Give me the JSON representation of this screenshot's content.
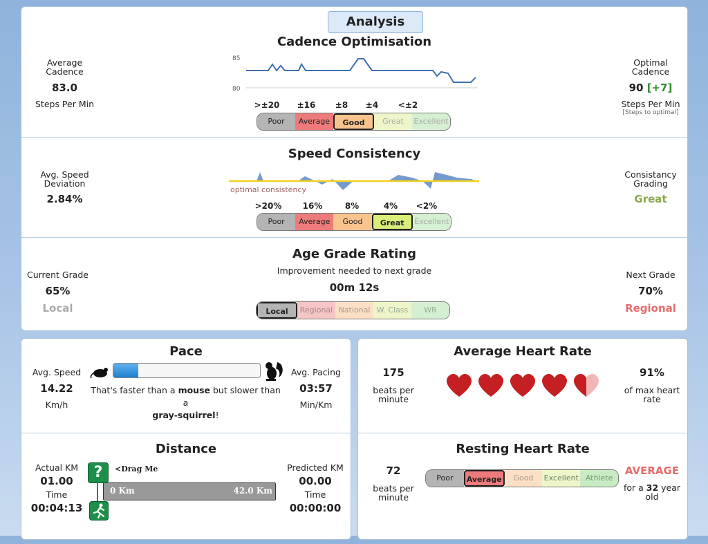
{
  "analysis": {
    "tab_label": "Analysis"
  },
  "cadence": {
    "title": "Cadence Optimisation",
    "avg_label": "Average\nCadence",
    "avg_value": "83.0",
    "avg_unit": "Steps Per Min",
    "optimal_label": "Optimal\nCadence",
    "optimal_value": "90",
    "optimal_delta": "[+7]",
    "optimal_unit": "Steps Per Min",
    "optimal_note": "[Steps to optimal]",
    "axis_high": "85",
    "axis_low": "80",
    "ticks": [
      ">±20",
      "±16",
      "±8",
      "±4",
      "<±2"
    ],
    "scale": [
      "Poor",
      "Average",
      "Good",
      "Great",
      "Excellent"
    ],
    "selected": "Good"
  },
  "speed": {
    "title": "Speed Consistency",
    "dev_label": "Avg. Speed\nDeviation",
    "dev_value": "2.84%",
    "grade_label": "Consistancy\nGrading",
    "grade_value": "Great",
    "chart_note": "optimal consistency",
    "ticks": [
      ">20%",
      "16%",
      "8%",
      "4%",
      "<2%"
    ],
    "scale": [
      "Poor",
      "Average",
      "Good",
      "Great",
      "Excellent"
    ],
    "selected": "Great"
  },
  "age": {
    "title": "Age Grade Rating",
    "subtitle": "Improvement needed to next grade",
    "time_needed": "00m 12s",
    "current_label": "Current Grade",
    "current_value": "65%",
    "current_grade": "Local",
    "next_label": "Next Grade",
    "next_value": "70%",
    "next_grade": "Regional",
    "scale": [
      "Local",
      "Regional",
      "National",
      "W. Class",
      "WR"
    ],
    "selected": "Local"
  },
  "pace": {
    "title": "Pace",
    "speed_label": "Avg. Speed",
    "speed_value": "14.22",
    "speed_unit": "Km/h",
    "pacing_label": "Avg. Pacing",
    "pacing_value": "03:57",
    "pacing_unit": "Min/Km",
    "compare_prefix": "That's faster than a ",
    "compare_a": "mouse",
    "compare_mid": " but slower than a",
    "compare_b": "gray-squirrel",
    "compare_suffix": "!",
    "progress": 0.17
  },
  "distance": {
    "title": "Distance",
    "actual_label": "Actual KM",
    "actual_value": "01.00",
    "time_label": "Time",
    "time_value": "00:04:13",
    "predicted_label": "Predicted KM",
    "predicted_value": "00.00",
    "pred_time_label": "Time",
    "pred_time_value": "00:00:00",
    "drag_label": "<Drag Me",
    "start_label": "0 Km",
    "end_label": "42.0 Km"
  },
  "avg_hr": {
    "title": "Average Heart Rate",
    "bpm_value": "175",
    "bpm_label": "beats per\nminute",
    "pct_value": "91%",
    "pct_label": "of max heart\nrate",
    "hearts_filled": 4.5,
    "hearts_total": 5
  },
  "rest_hr": {
    "title": "Resting Heart Rate",
    "bpm_value": "72",
    "bpm_label": "beats per\nminute",
    "rating": "AVERAGE",
    "age_prefix": "for a ",
    "age_value": "32",
    "age_suffix": " year\nold",
    "scale": [
      "Poor",
      "Average",
      "Good",
      "Excellent",
      "Athlete"
    ],
    "selected": "Average"
  },
  "colors": {
    "poor": "#b4b4b4",
    "average": "#ee7b7b",
    "good": "#f8c48e",
    "great": "#e6f1a8",
    "excellent": "#c8ebc4",
    "great_text": "#8aa84a",
    "regional_text": "#e86b6b",
    "green_delta": "#2e8b2e",
    "progress": "#2b8fd6"
  }
}
